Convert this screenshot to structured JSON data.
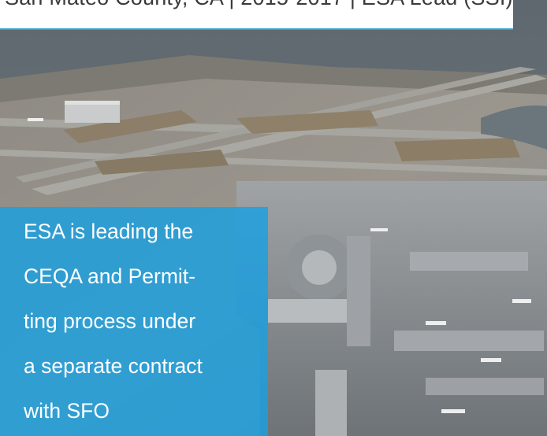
{
  "caption": {
    "text": "San Mateo County, CA | 2015-2017 | ESA Lead (SSI)"
  },
  "callout": {
    "lines": [
      "ESA is leading the",
      "CEQA and Permit-",
      "ting process under",
      "a separate contract",
      "with SFO"
    ]
  },
  "colors": {
    "accent": "#2aa3dc",
    "callout_bg": "#1aa0e1",
    "water": "#6f7a80"
  }
}
